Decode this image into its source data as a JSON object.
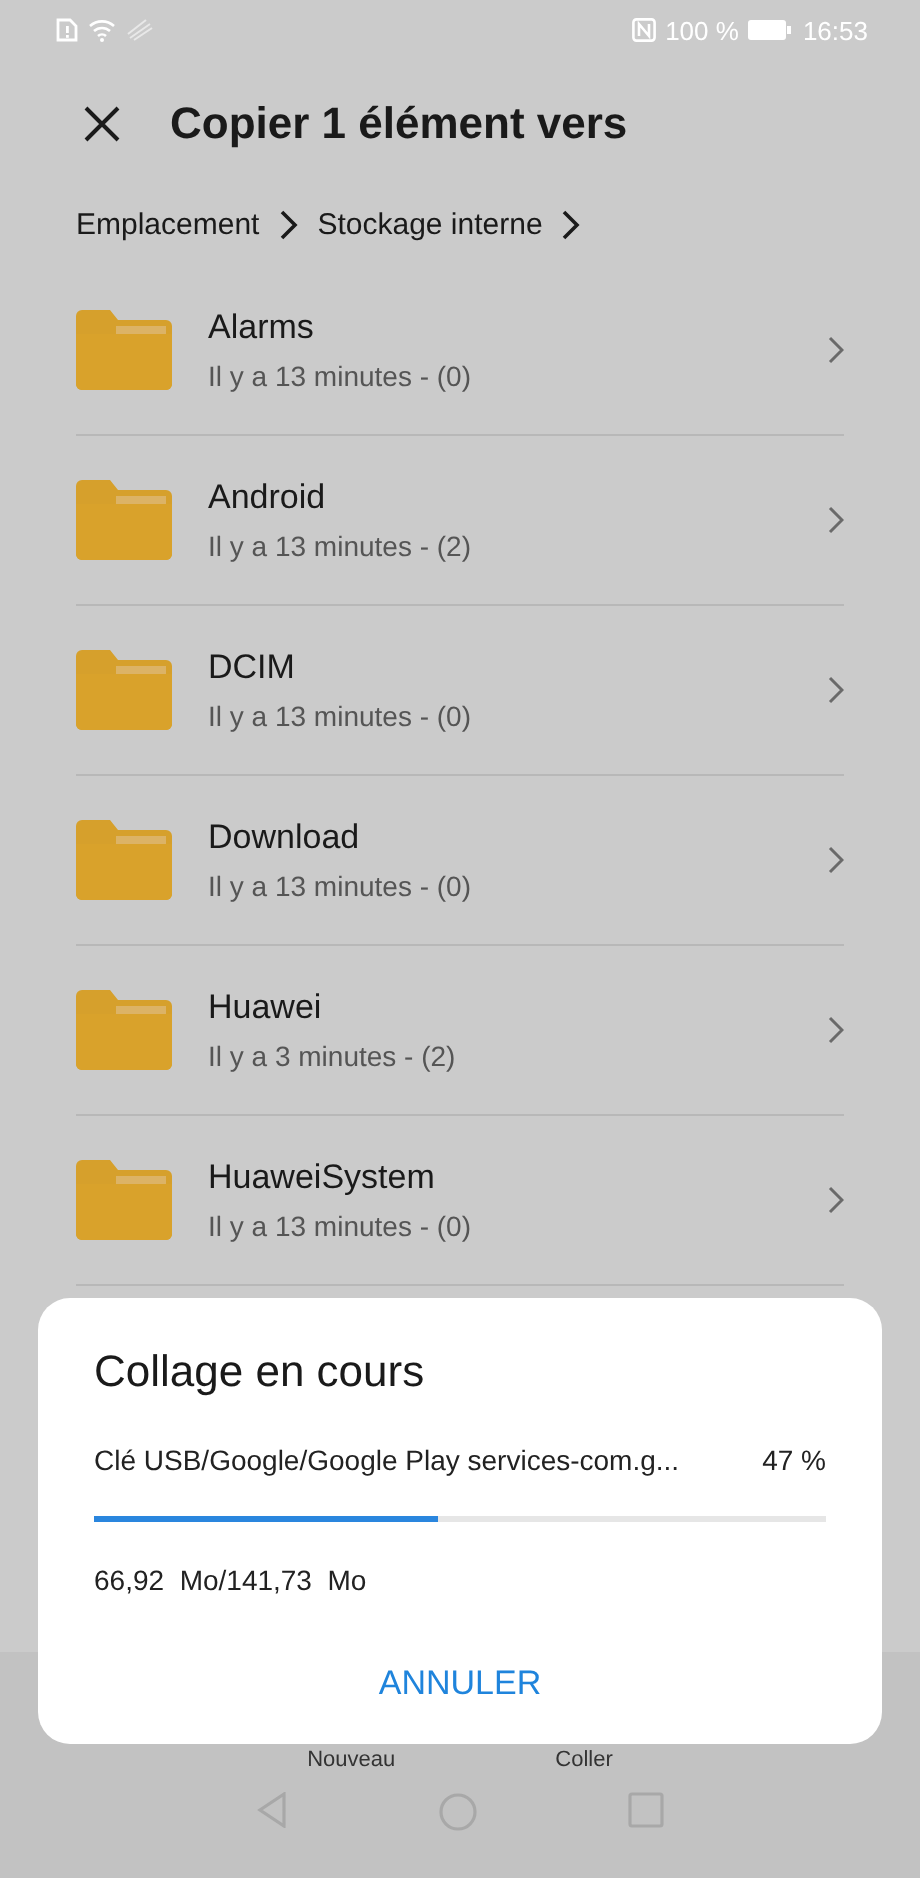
{
  "status_bar": {
    "battery": "100 %",
    "time": "16:53"
  },
  "header": {
    "title": "Copier 1 élément vers"
  },
  "breadcrumbs": [
    "Emplacement",
    "Stockage interne"
  ],
  "folders": [
    {
      "name": "Alarms",
      "details": "Il y a 13 minutes - (0)"
    },
    {
      "name": "Android",
      "details": "Il y a 13 minutes - (2)"
    },
    {
      "name": "DCIM",
      "details": "Il y a 13 minutes - (0)"
    },
    {
      "name": "Download",
      "details": "Il y a 13 minutes - (0)"
    },
    {
      "name": "Huawei",
      "details": "Il y a 3 minutes - (2)"
    },
    {
      "name": "HuaweiSystem",
      "details": "Il y a 13 minutes - (0)"
    }
  ],
  "bottom_bar": [
    "Nouveau",
    "Coller"
  ],
  "dialog": {
    "title": "Collage en cours",
    "file": "Clé USB/Google/Google Play services-com.g...",
    "percent": "47 %",
    "level": 0.47,
    "size": "66,92  Mo/141,73  Mo",
    "button": "ANNULER"
  }
}
